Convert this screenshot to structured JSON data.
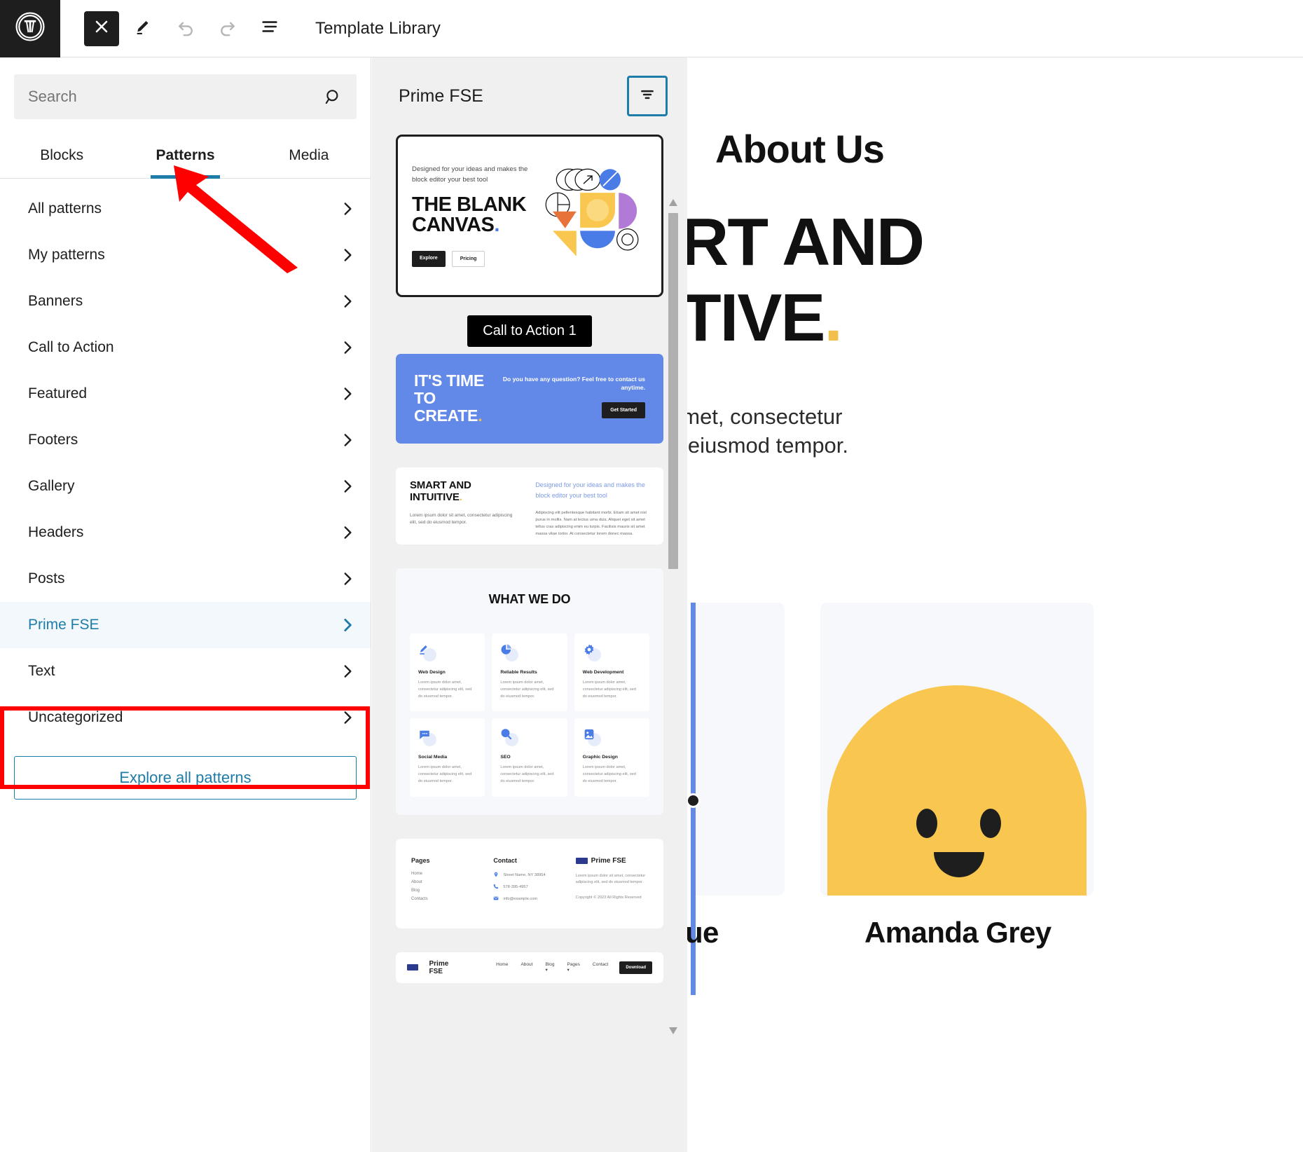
{
  "toolbar": {
    "logo_icon": "wordpress-logo",
    "close_icon": "close-icon",
    "edit_icon": "pencil-icon",
    "undo_icon": "undo-icon",
    "redo_icon": "redo-icon",
    "listview_icon": "list-view-icon",
    "title": "Template Library"
  },
  "inserter": {
    "search": {
      "value": "",
      "placeholder": "Search",
      "icon": "search-icon"
    },
    "tabs": [
      {
        "label": "Blocks",
        "active": false
      },
      {
        "label": "Patterns",
        "active": true
      },
      {
        "label": "Media",
        "active": false
      }
    ],
    "categories": [
      {
        "label": "All patterns",
        "selected": false
      },
      {
        "label": "My patterns",
        "selected": false
      },
      {
        "label": "Banners",
        "selected": false
      },
      {
        "label": "Call to Action",
        "selected": false
      },
      {
        "label": "Featured",
        "selected": false
      },
      {
        "label": "Footers",
        "selected": false
      },
      {
        "label": "Gallery",
        "selected": false
      },
      {
        "label": "Headers",
        "selected": false
      },
      {
        "label": "Posts",
        "selected": false
      },
      {
        "label": "Prime FSE",
        "selected": true
      },
      {
        "label": "Text",
        "selected": false
      },
      {
        "label": "Uncategorized",
        "selected": false
      }
    ],
    "explore_button": "Explore all patterns",
    "chevron_icon": "chevron-right-icon"
  },
  "annotations": {
    "arrow_color": "#ff0000",
    "box_color": "#ff0000",
    "arrow_target": "Patterns",
    "box_target": "Prime FSE"
  },
  "preview_panel": {
    "title": "Prime FSE",
    "filter_button_icon": "filter-icon",
    "scrollbar": {
      "up_icon": "triangle-up-icon",
      "down_icon": "triangle-down-icon"
    },
    "tooltip": "Call to Action 1",
    "patterns": {
      "blank_canvas": {
        "subtitle": "Designed for your ideas and makes the block editor your best tool",
        "heading_line1": "THE BLANK",
        "heading_line2": "CANVAS",
        "heading_dot": ".",
        "buttons": [
          "Explore",
          "Pricing"
        ]
      },
      "cta": {
        "heading_line1": "IT'S TIME",
        "heading_line2": "TO CREATE",
        "heading_dot": ".",
        "question": "Do you have any question? Feel free to contact us anytime.",
        "button": "Get Started"
      },
      "smart_intuitive": {
        "heading_line1": "SMART AND",
        "heading_line2": "INTUITIVE",
        "heading_dot": ".",
        "left_paragraph": "Lorem ipsum dolor sit amet, consectetur adipiscing elit, sed do eiusmod tempor.",
        "lead": "Designed for your ideas and makes the block editor your best tool",
        "body": "Adipiscing elit pellentesque habitant morbi. Etiam sit amet nisl purus in mollis. Nam at lectus urna duis. Aliquet eget sit amet tellus cras adipiscing enim eu turpis. Facilisis mauris sit amet massa vitae tortor. At consectetur lorem donec massa."
      },
      "what_we_do": {
        "heading": "WHAT WE DO",
        "services": [
          {
            "icon": "pen-icon",
            "title": "Web Design",
            "text": "Lorem ipsum dolor amet, consectetur adipiscing elit, sed do eiusmod tempor."
          },
          {
            "icon": "pie-chart-icon",
            "title": "Reliable Results",
            "text": "Lorem ipsum dolor amet, consectetur adipiscing elit, sed do eiusmod tempor."
          },
          {
            "icon": "gear-icon",
            "title": "Web Development",
            "text": "Lorem ipsum dolor amet, consectetur adipiscing elit, sed do eiusmod tempor."
          },
          {
            "icon": "chat-bubble-icon",
            "title": "Social Media",
            "text": "Lorem ipsum dolor amet, consectetur adipiscing elit, sed do eiusmod tempor."
          },
          {
            "icon": "magnifier-icon",
            "title": "SEO",
            "text": "Lorem ipsum dolor amet, consectetur adipiscing elit, sed do eiusmod tempor."
          },
          {
            "icon": "image-icon",
            "title": "Graphic Design",
            "text": "Lorem ipsum dolor amet, consectetur adipiscing elit, sed do eiusmod tempor."
          }
        ]
      },
      "footer": {
        "pages_heading": "Pages",
        "pages": [
          "Home",
          "About",
          "Blog",
          "Contacts"
        ],
        "contact_heading": "Contact",
        "address": "Street Name, NY 38954",
        "phone": "578-395-4957",
        "email": "info@example.com",
        "brand": "Prime FSE",
        "brand_text": "Lorem ipsum dolor sit amet, consectetur adipiscing elit, sed do eiusmod tempor.",
        "copyright": "Copyright © 2023 All Rights Reserved"
      },
      "header": {
        "brand": "Prime FSE",
        "nav": [
          "Home",
          "About",
          "Blog  ▾",
          "Pages  ▾",
          "Contact"
        ],
        "button": "Download"
      }
    }
  },
  "canvas": {
    "about_heading": "About Us",
    "big_line1": "RT AND",
    "big_line2": "TIVE",
    "big_dot": ".",
    "paragraph_line1": "amet, consectetur",
    "paragraph_line2": "o eiusmod tempor.",
    "member_name_left": "ue",
    "member_name_right": "Amanda Grey",
    "avatar_icon": "smiley-avatar",
    "insertion_indicator_color": "#6289e8"
  }
}
